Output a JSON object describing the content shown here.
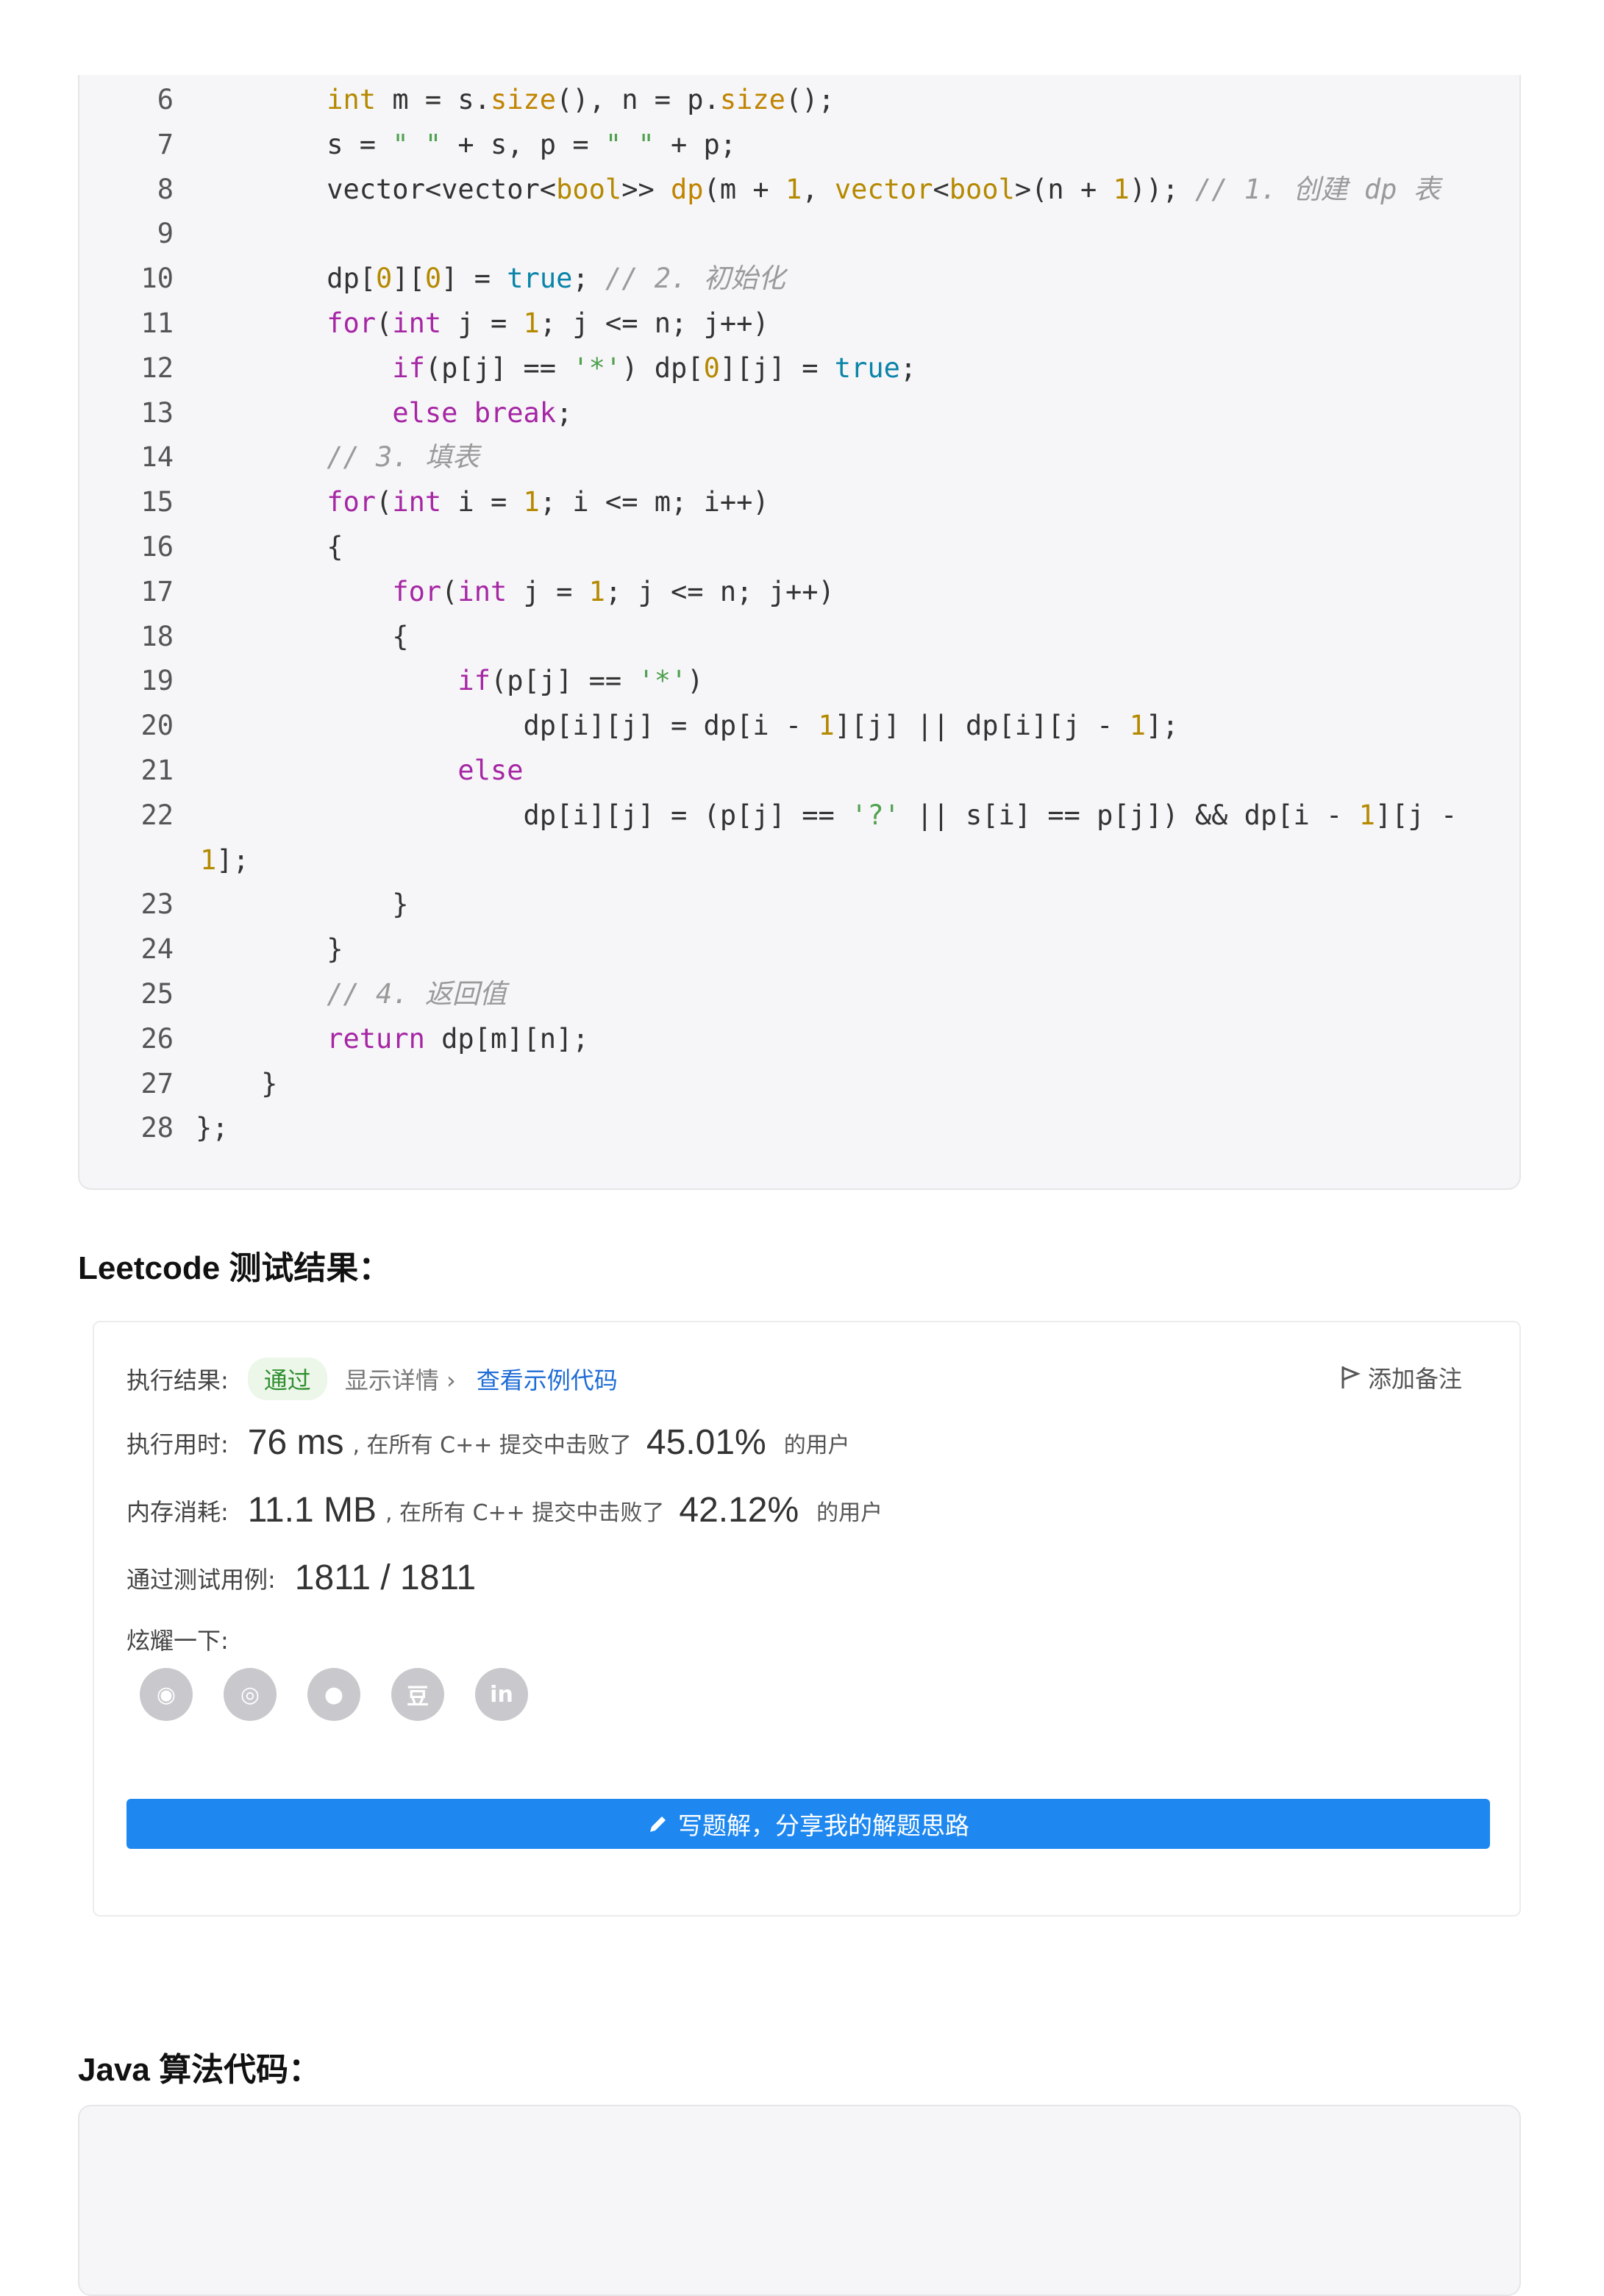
{
  "code_lines": [
    {
      "num": "6",
      "html": "        <span class=\"ty\">int</span> m = s.<span class=\"fn\">size</span>(), n = p.<span class=\"fn\">size</span>();"
    },
    {
      "num": "7",
      "html": "        s = <span class=\"str\">\" \"</span> + s, p = <span class=\"str\">\" \"</span> + p;"
    },
    {
      "num": "8",
      "html": "        vector&lt;vector&lt;<span class=\"ty\">bool</span>&gt;&gt; <span class=\"fn\">dp</span>(m + <span class=\"num\">1</span>, <span class=\"ty\">vector</span>&lt;<span class=\"ty\">bool</span>&gt;(n + <span class=\"num\">1</span>)); <span class=\"cm\">// 1. 创建 dp 表</span>"
    },
    {
      "num": "9",
      "html": ""
    },
    {
      "num": "10",
      "html": "        dp[<span class=\"num\">0</span>][<span class=\"num\">0</span>] = <span class=\"bool\">true</span>; <span class=\"cm\">// 2. 初始化</span>"
    },
    {
      "num": "11",
      "html": "        <span class=\"kw\">for</span>(<span class=\"kw\">int</span> j = <span class=\"num\">1</span>; j &lt;= n; j++)"
    },
    {
      "num": "12",
      "html": "            <span class=\"kw\">if</span>(p[j] == <span class=\"str\">'*'</span>) dp[<span class=\"num\">0</span>][j] = <span class=\"bool\">true</span>;"
    },
    {
      "num": "13",
      "html": "            <span class=\"kw\">else break</span>;"
    },
    {
      "num": "14",
      "html": "        <span class=\"cm\">// 3. 填表</span>"
    },
    {
      "num": "15",
      "html": "        <span class=\"kw\">for</span>(<span class=\"kw\">int</span> i = <span class=\"num\">1</span>; i &lt;= m; i++)"
    },
    {
      "num": "16",
      "html": "        {"
    },
    {
      "num": "17",
      "html": "            <span class=\"kw\">for</span>(<span class=\"kw\">int</span> j = <span class=\"num\">1</span>; j &lt;= n; j++)"
    },
    {
      "num": "18",
      "html": "            {"
    },
    {
      "num": "19",
      "html": "                <span class=\"kw\">if</span>(p[j] == <span class=\"str\">'*'</span>)"
    },
    {
      "num": "20",
      "html": "                    dp[i][j] = dp[i - <span class=\"num\">1</span>][j] || dp[i][j - <span class=\"num\">1</span>];"
    },
    {
      "num": "21",
      "html": "                <span class=\"kw\">else</span>"
    },
    {
      "num": "22",
      "html": "                    dp[i][j] = (p[j] == <span class=\"str\">'?'</span> || s[i] == p[j]) &amp;&amp; dp[i - <span class=\"num\">1</span>][j -"
    },
    {
      "num": "",
      "html": "<span class=\"num\">1</span>];"
    },
    {
      "num": "23",
      "html": "            }"
    },
    {
      "num": "24",
      "html": "        }"
    },
    {
      "num": "25",
      "html": "        <span class=\"cm\">// 4. 返回值</span>"
    },
    {
      "num": "26",
      "html": "        <span class=\"kw\">return</span> dp[m][n];"
    },
    {
      "num": "27",
      "html": "    }"
    },
    {
      "num": "28",
      "html": "};"
    }
  ],
  "headings": {
    "leetcode": "Leetcode 测试结果：",
    "java": "Java 算法代码："
  },
  "result": {
    "exec_label": "执行结果:",
    "status": "通过",
    "details": "显示详情 ›",
    "example_code": "查看示例代码",
    "add_note": "添加备注",
    "time_label": "执行用时:",
    "time_value": "76 ms",
    "time_text": ", 在所有 C++ 提交中击败了",
    "time_pct": "45.01%",
    "time_suffix": "的用户",
    "mem_label": "内存消耗:",
    "mem_value": "11.1 MB",
    "mem_text": ", 在所有 C++ 提交中击败了",
    "mem_pct": "42.12%",
    "mem_suffix": "的用户",
    "cases_label": "通过测试用例:",
    "cases_value": "1811 / 1811",
    "share_label": "炫耀一下:",
    "share_icons": [
      "wechat-icon",
      "weibo-icon",
      "qq-icon",
      "douban-icon",
      "linkedin-icon"
    ],
    "share_glyphs": [
      "◉",
      "◎",
      "●",
      "豆",
      "in"
    ],
    "cta": "写题解，分享我的解题思路"
  },
  "colors": {
    "accent": "#1e88f0",
    "pass": "#2f8f2f",
    "link": "#1e6cd6"
  }
}
